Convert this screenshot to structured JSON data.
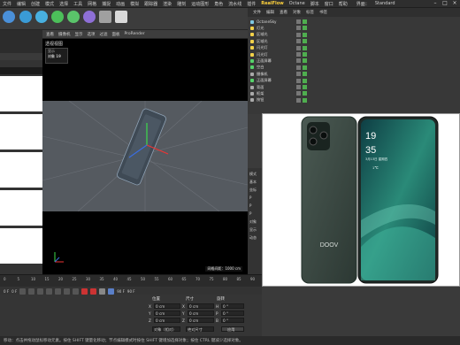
{
  "menubar": {
    "items": [
      "文件",
      "编辑",
      "创建",
      "模式",
      "选择",
      "工具",
      "网格",
      "捕捉",
      "动画",
      "模拟",
      "跟踪器",
      "渲染",
      "雕刻",
      "运动图形",
      "角色",
      "流水线",
      "插件",
      "RealFlow",
      "Octane",
      "脚本",
      "窗口",
      "帮助"
    ],
    "layout_label": "界面：",
    "layout_value": "Standard"
  },
  "viewport": {
    "header": [
      "查看",
      "摄像机",
      "显示",
      "选项",
      "过滤",
      "面板",
      "ProRender"
    ],
    "title": "透视视图",
    "box_label_1": "显示",
    "box_label_2": "对象",
    "box_value": "19",
    "scale_label": "网格间距：1000 cm"
  },
  "object_manager": {
    "header": [
      "文件",
      "编辑",
      "查看",
      "对象",
      "标签",
      "书签"
    ],
    "rows": [
      {
        "name": "OctaneSky",
        "color": "#7ec8e3"
      },
      {
        "name": "灯光",
        "color": "#f2d14a"
      },
      {
        "name": "区域光",
        "color": "#f2d14a"
      },
      {
        "name": "区域光",
        "color": "#f2d14a"
      },
      {
        "name": "闪光灯",
        "color": "#f2d14a"
      },
      {
        "name": "闪光灯",
        "color": "#f2d14a"
      },
      {
        "name": "正面屏幕",
        "color": "#55d36a"
      },
      {
        "name": "空白",
        "color": "#55d36a"
      },
      {
        "name": "摄像机",
        "color": "#aaaaaa"
      },
      {
        "name": "正面屏幕",
        "color": "#55d36a"
      },
      {
        "name": "背面",
        "color": "#aaaaaa"
      },
      {
        "name": "框架",
        "color": "#aaaaaa"
      },
      {
        "name": "按钮",
        "color": "#aaaaaa"
      }
    ]
  },
  "attributes": {
    "labels": [
      "模式",
      "基本",
      "坐标",
      "P",
      "P",
      "P",
      "对象",
      "显示",
      "动态"
    ]
  },
  "product": {
    "brand": "DOOV",
    "time_hour": "19",
    "time_min": "35",
    "date": "3月13日 星期四",
    "temp": "1℃"
  },
  "timeline": {
    "ticks": [
      "0",
      "5",
      "10",
      "15",
      "20",
      "25",
      "30",
      "35",
      "40",
      "45",
      "50",
      "55",
      "60",
      "65",
      "70",
      "75",
      "80",
      "85",
      "90"
    ],
    "start_frame": "0 F",
    "current_frame": "0 F",
    "end_frame": "90 F",
    "end_frame_2": "90 F",
    "right_value": "0 F"
  },
  "coords": {
    "head_pos": "位置",
    "head_size": "尺寸",
    "head_rot": "旋转",
    "x_label": "X",
    "y_label": "Y",
    "z_label": "Z",
    "h_label": "H",
    "p_label": "P",
    "b_label": "B",
    "x": "0 cm",
    "y": "0 cm",
    "z": "0 cm",
    "sx": "0 cm",
    "sy": "0 cm",
    "sz": "0 cm",
    "h": "0 °",
    "p": "0 °",
    "b": "0 °",
    "mode1": "对象（相对）",
    "mode2": "绝对尺寸",
    "apply": "应用"
  },
  "status": {
    "text": "移动：点击并拖动鼠标移动元素。按住 SHIFT 键量化移动；节点编辑模式时按住 SHIFT 键增加选择对象；按住 CTRL 键减少选择对象。"
  },
  "colors": {
    "accent": "#ffd23c",
    "phone_body": "#3c4a44",
    "screen_teal": "#1f6b62"
  },
  "icons": [
    "minimize-icon",
    "maximize-icon",
    "close-icon",
    "undo-icon",
    "cube-icon",
    "play-icon",
    "record-icon"
  ]
}
